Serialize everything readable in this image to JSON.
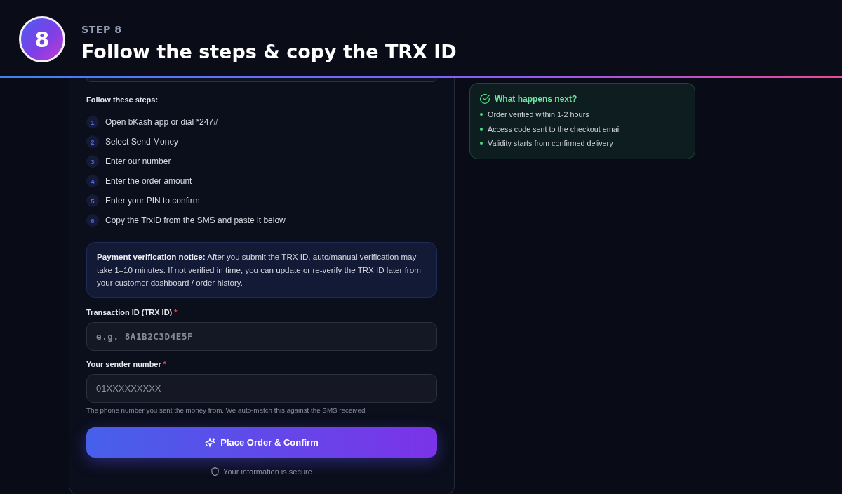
{
  "header": {
    "badge": "8",
    "step_label": "STEP 8",
    "title": "Follow the steps & copy the TRX ID"
  },
  "payment_card": {
    "steps_heading": "Follow these steps:",
    "steps": [
      {
        "number": "1",
        "text": "Open bKash app or dial *247#"
      },
      {
        "number": "2",
        "text": "Select Send Money"
      },
      {
        "number": "3",
        "text": "Enter our number"
      },
      {
        "number": "4",
        "text": "Enter the order amount"
      },
      {
        "number": "5",
        "text": "Enter your PIN to confirm"
      },
      {
        "number": "6",
        "text": "Copy the TrxID from the SMS and paste it below"
      }
    ],
    "notice": "**Payment verification notice:** After you submit the TRX ID, auto/manual verification may take 1–10 minutes. If not verified in time, you can update or re-verify the TRX ID later from your customer dashboard / order history.",
    "fields": [
      {
        "kind": "code",
        "label": "Transaction ID (TRX ID)",
        "required_mark": "*",
        "placeholder": "e.g. 8A1B2C3D4E5F"
      },
      {
        "kind": "phone",
        "label": "Your sender number",
        "required_mark": "*",
        "placeholder": "01XXXXXXXXX",
        "hint": "The phone number you sent the money from. We auto-match this against the SMS received."
      }
    ],
    "submit_button": "Place Order & Confirm",
    "security_note": "Your information is secure"
  },
  "next_steps": {
    "title": "What happens next?",
    "items": [
      "Order verified within 1-2 hours",
      "Access code sent to the checkout email",
      "Validity starts from confirmed delivery"
    ]
  }
}
